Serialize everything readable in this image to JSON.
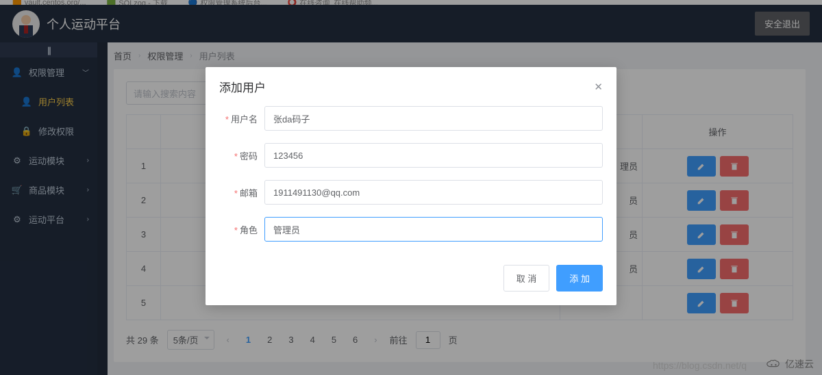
{
  "browser": {
    "tabs": [
      "vault.centos.org/...",
      "SQLzog - 下载",
      "权限管理系统后台...",
      "在线咨询_在线帮助频..."
    ]
  },
  "header": {
    "title": "个人运动平台",
    "logout": "安全退出"
  },
  "sidebar": {
    "groups": [
      {
        "label": "权限管理",
        "icon": "user-icon",
        "items": [
          {
            "label": "用户列表",
            "icon": "person-icon",
            "active": true
          },
          {
            "label": "修改权限",
            "icon": "lock-icon"
          }
        ]
      },
      {
        "label": "运动模块",
        "icon": "gear-icon"
      },
      {
        "label": "商品模块",
        "icon": "cart-icon"
      },
      {
        "label": "运动平台",
        "icon": "gear-icon"
      }
    ]
  },
  "breadcrumb": {
    "items": [
      "首页",
      "权限管理",
      "用户列表"
    ]
  },
  "search": {
    "placeholder": "请输入搜索内容"
  },
  "table": {
    "ops_header": "操作",
    "rows": [
      {
        "n": "1",
        "role": "理员"
      },
      {
        "n": "2",
        "role": "员"
      },
      {
        "n": "3",
        "role": "员"
      },
      {
        "n": "4",
        "role": "员"
      },
      {
        "n": "5",
        "role": ""
      }
    ],
    "row_visible_role_fragment": "理员"
  },
  "pagination": {
    "total_text": "共 29 条",
    "page_size": "5条/页",
    "pages": [
      "1",
      "2",
      "3",
      "4",
      "5",
      "6"
    ],
    "active": "1",
    "goto_label_pre": "前往",
    "goto_value": "1",
    "goto_label_post": "页"
  },
  "dialog": {
    "title": "添加用户",
    "fields": {
      "username": {
        "label": "用户名",
        "value": "张da码子"
      },
      "password": {
        "label": "密码",
        "value": "123456"
      },
      "email": {
        "label": "邮箱",
        "value": "1911491130@qq.com"
      },
      "role": {
        "label": "角色",
        "value": "管理员"
      }
    },
    "cancel": "取 消",
    "confirm": "添 加"
  },
  "watermark": "https://blog.csdn.net/q",
  "brand": "亿速云"
}
